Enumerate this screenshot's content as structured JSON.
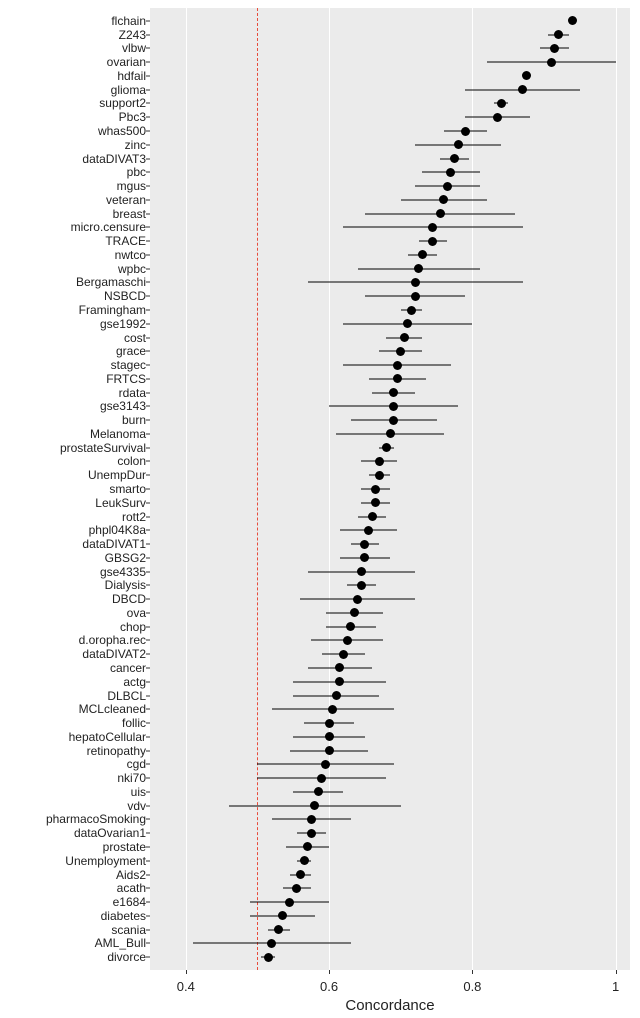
{
  "chart_data": {
    "type": "dot-interval",
    "xlabel": "Concordance",
    "ylabel": "",
    "xlim": [
      0.35,
      1.02
    ],
    "x_ticks": [
      0.4,
      0.6,
      0.8,
      1.0
    ],
    "reference_line": 0.5,
    "series": [
      {
        "name": "flchain",
        "x": 0.94,
        "lo": 0.935,
        "hi": 0.945
      },
      {
        "name": "Z243",
        "x": 0.92,
        "lo": 0.905,
        "hi": 0.935
      },
      {
        "name": "vlbw",
        "x": 0.915,
        "lo": 0.895,
        "hi": 0.935
      },
      {
        "name": "ovarian",
        "x": 0.91,
        "lo": 0.82,
        "hi": 1.0
      },
      {
        "name": "hdfail",
        "x": 0.875,
        "lo": 0.87,
        "hi": 0.88
      },
      {
        "name": "glioma",
        "x": 0.87,
        "lo": 0.79,
        "hi": 0.95
      },
      {
        "name": "support2",
        "x": 0.84,
        "lo": 0.83,
        "hi": 0.85
      },
      {
        "name": "Pbc3",
        "x": 0.835,
        "lo": 0.79,
        "hi": 0.88
      },
      {
        "name": "whas500",
        "x": 0.79,
        "lo": 0.76,
        "hi": 0.82
      },
      {
        "name": "zinc",
        "x": 0.78,
        "lo": 0.72,
        "hi": 0.84
      },
      {
        "name": "dataDIVAT3",
        "x": 0.775,
        "lo": 0.755,
        "hi": 0.795
      },
      {
        "name": "pbc",
        "x": 0.77,
        "lo": 0.73,
        "hi": 0.81
      },
      {
        "name": "mgus",
        "x": 0.765,
        "lo": 0.72,
        "hi": 0.81
      },
      {
        "name": "veteran",
        "x": 0.76,
        "lo": 0.7,
        "hi": 0.82
      },
      {
        "name": "breast",
        "x": 0.755,
        "lo": 0.65,
        "hi": 0.86
      },
      {
        "name": "micro.censure",
        "x": 0.745,
        "lo": 0.62,
        "hi": 0.87
      },
      {
        "name": "TRACE",
        "x": 0.745,
        "lo": 0.725,
        "hi": 0.765
      },
      {
        "name": "nwtco",
        "x": 0.73,
        "lo": 0.71,
        "hi": 0.75
      },
      {
        "name": "wpbc",
        "x": 0.725,
        "lo": 0.64,
        "hi": 0.81
      },
      {
        "name": "Bergamaschi",
        "x": 0.72,
        "lo": 0.57,
        "hi": 0.87
      },
      {
        "name": "NSBCD",
        "x": 0.72,
        "lo": 0.65,
        "hi": 0.79
      },
      {
        "name": "Framingham",
        "x": 0.715,
        "lo": 0.7,
        "hi": 0.73
      },
      {
        "name": "gse1992",
        "x": 0.71,
        "lo": 0.62,
        "hi": 0.8
      },
      {
        "name": "cost",
        "x": 0.705,
        "lo": 0.68,
        "hi": 0.73
      },
      {
        "name": "grace",
        "x": 0.7,
        "lo": 0.67,
        "hi": 0.73
      },
      {
        "name": "stagec",
        "x": 0.695,
        "lo": 0.62,
        "hi": 0.77
      },
      {
        "name": "FRTCS",
        "x": 0.695,
        "lo": 0.655,
        "hi": 0.735
      },
      {
        "name": "rdata",
        "x": 0.69,
        "lo": 0.66,
        "hi": 0.72
      },
      {
        "name": "gse3143",
        "x": 0.69,
        "lo": 0.6,
        "hi": 0.78
      },
      {
        "name": "burn",
        "x": 0.69,
        "lo": 0.63,
        "hi": 0.75
      },
      {
        "name": "Melanoma",
        "x": 0.685,
        "lo": 0.61,
        "hi": 0.76
      },
      {
        "name": "prostateSurvival",
        "x": 0.68,
        "lo": 0.67,
        "hi": 0.69
      },
      {
        "name": "colon",
        "x": 0.67,
        "lo": 0.645,
        "hi": 0.695
      },
      {
        "name": "UnempDur",
        "x": 0.67,
        "lo": 0.655,
        "hi": 0.685
      },
      {
        "name": "smarto",
        "x": 0.665,
        "lo": 0.645,
        "hi": 0.685
      },
      {
        "name": "LeukSurv",
        "x": 0.665,
        "lo": 0.645,
        "hi": 0.685
      },
      {
        "name": "rott2",
        "x": 0.66,
        "lo": 0.64,
        "hi": 0.68
      },
      {
        "name": "phpl04K8a",
        "x": 0.655,
        "lo": 0.615,
        "hi": 0.695
      },
      {
        "name": "dataDIVAT1",
        "x": 0.65,
        "lo": 0.63,
        "hi": 0.67
      },
      {
        "name": "GBSG2",
        "x": 0.65,
        "lo": 0.615,
        "hi": 0.685
      },
      {
        "name": "gse4335",
        "x": 0.645,
        "lo": 0.57,
        "hi": 0.72
      },
      {
        "name": "Dialysis",
        "x": 0.645,
        "lo": 0.625,
        "hi": 0.665
      },
      {
        "name": "DBCD",
        "x": 0.64,
        "lo": 0.56,
        "hi": 0.72
      },
      {
        "name": "ova",
        "x": 0.635,
        "lo": 0.595,
        "hi": 0.675
      },
      {
        "name": "chop",
        "x": 0.63,
        "lo": 0.595,
        "hi": 0.665
      },
      {
        "name": "d.oropha.rec",
        "x": 0.625,
        "lo": 0.575,
        "hi": 0.675
      },
      {
        "name": "dataDIVAT2",
        "x": 0.62,
        "lo": 0.59,
        "hi": 0.65
      },
      {
        "name": "cancer",
        "x": 0.615,
        "lo": 0.57,
        "hi": 0.66
      },
      {
        "name": "actg",
        "x": 0.615,
        "lo": 0.55,
        "hi": 0.68
      },
      {
        "name": "DLBCL",
        "x": 0.61,
        "lo": 0.55,
        "hi": 0.67
      },
      {
        "name": "MCLcleaned",
        "x": 0.605,
        "lo": 0.52,
        "hi": 0.69
      },
      {
        "name": "follic",
        "x": 0.6,
        "lo": 0.565,
        "hi": 0.635
      },
      {
        "name": "hepatoCellular",
        "x": 0.6,
        "lo": 0.55,
        "hi": 0.65
      },
      {
        "name": "retinopathy",
        "x": 0.6,
        "lo": 0.545,
        "hi": 0.655
      },
      {
        "name": "cgd",
        "x": 0.595,
        "lo": 0.5,
        "hi": 0.69
      },
      {
        "name": "nki70",
        "x": 0.59,
        "lo": 0.5,
        "hi": 0.68
      },
      {
        "name": "uis",
        "x": 0.585,
        "lo": 0.55,
        "hi": 0.62
      },
      {
        "name": "vdv",
        "x": 0.58,
        "lo": 0.46,
        "hi": 0.7
      },
      {
        "name": "pharmacoSmoking",
        "x": 0.575,
        "lo": 0.52,
        "hi": 0.63
      },
      {
        "name": "dataOvarian1",
        "x": 0.575,
        "lo": 0.555,
        "hi": 0.595
      },
      {
        "name": "prostate",
        "x": 0.57,
        "lo": 0.54,
        "hi": 0.6
      },
      {
        "name": "Unemployment",
        "x": 0.565,
        "lo": 0.555,
        "hi": 0.575
      },
      {
        "name": "Aids2",
        "x": 0.56,
        "lo": 0.545,
        "hi": 0.575
      },
      {
        "name": "acath",
        "x": 0.555,
        "lo": 0.535,
        "hi": 0.575
      },
      {
        "name": "e1684",
        "x": 0.545,
        "lo": 0.49,
        "hi": 0.6
      },
      {
        "name": "diabetes",
        "x": 0.535,
        "lo": 0.49,
        "hi": 0.58
      },
      {
        "name": "scania",
        "x": 0.53,
        "lo": 0.515,
        "hi": 0.545
      },
      {
        "name": "AML_Bull",
        "x": 0.52,
        "lo": 0.41,
        "hi": 0.63
      },
      {
        "name": "divorce",
        "x": 0.515,
        "lo": 0.505,
        "hi": 0.525
      }
    ]
  }
}
